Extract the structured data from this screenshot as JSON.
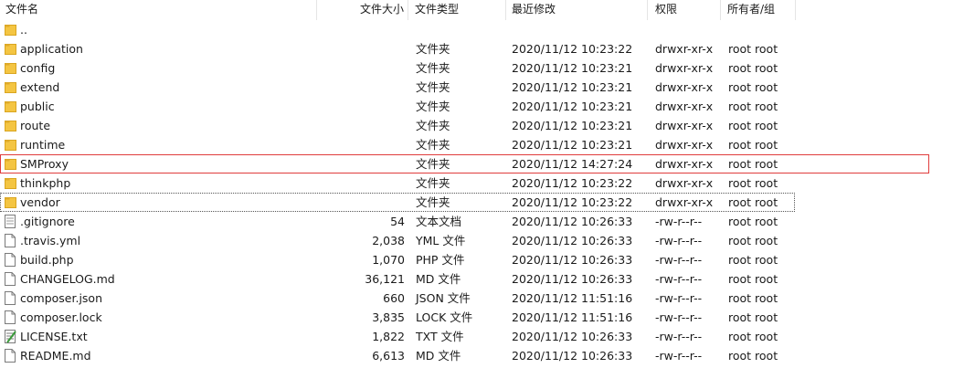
{
  "columns": {
    "name": "文件名",
    "size": "文件大小",
    "type": "文件类型",
    "mtime": "最近修改",
    "perm": "权限",
    "owner": "所有者/组"
  },
  "colors": {
    "folder": "#f4c542",
    "selection_outline": "#e03c3c"
  },
  "rows": [
    {
      "name": "..",
      "size": "",
      "type": "",
      "mtime": "",
      "perm": "",
      "owner": "",
      "icon": "folder-icon"
    },
    {
      "name": "application",
      "size": "",
      "type": "文件夹",
      "mtime": "2020/11/12 10:23:22",
      "perm": "drwxr-xr-x",
      "owner": "root root",
      "icon": "folder-icon"
    },
    {
      "name": "config",
      "size": "",
      "type": "文件夹",
      "mtime": "2020/11/12 10:23:21",
      "perm": "drwxr-xr-x",
      "owner": "root root",
      "icon": "folder-icon"
    },
    {
      "name": "extend",
      "size": "",
      "type": "文件夹",
      "mtime": "2020/11/12 10:23:21",
      "perm": "drwxr-xr-x",
      "owner": "root root",
      "icon": "folder-icon"
    },
    {
      "name": "public",
      "size": "",
      "type": "文件夹",
      "mtime": "2020/11/12 10:23:21",
      "perm": "drwxr-xr-x",
      "owner": "root root",
      "icon": "folder-icon"
    },
    {
      "name": "route",
      "size": "",
      "type": "文件夹",
      "mtime": "2020/11/12 10:23:21",
      "perm": "drwxr-xr-x",
      "owner": "root root",
      "icon": "folder-icon"
    },
    {
      "name": "runtime",
      "size": "",
      "type": "文件夹",
      "mtime": "2020/11/12 10:23:21",
      "perm": "drwxr-xr-x",
      "owner": "root root",
      "icon": "folder-icon"
    },
    {
      "name": "SMProxy",
      "size": "",
      "type": "文件夹",
      "mtime": "2020/11/12 14:27:24",
      "perm": "drwxr-xr-x",
      "owner": "root root",
      "icon": "folder-icon"
    },
    {
      "name": "thinkphp",
      "size": "",
      "type": "文件夹",
      "mtime": "2020/11/12 10:23:22",
      "perm": "drwxr-xr-x",
      "owner": "root root",
      "icon": "folder-icon"
    },
    {
      "name": "vendor",
      "size": "",
      "type": "文件夹",
      "mtime": "2020/11/12 10:23:22",
      "perm": "drwxr-xr-x",
      "owner": "root root",
      "icon": "folder-icon"
    },
    {
      "name": ".gitignore",
      "size": "54",
      "type": "文本文档",
      "mtime": "2020/11/12 10:26:33",
      "perm": "-rw-r--r--",
      "owner": "root root",
      "icon": "text-file-icon"
    },
    {
      "name": ".travis.yml",
      "size": "2,038",
      "type": "YML 文件",
      "mtime": "2020/11/12 10:26:33",
      "perm": "-rw-r--r--",
      "owner": "root root",
      "icon": "file-icon"
    },
    {
      "name": "build.php",
      "size": "1,070",
      "type": "PHP 文件",
      "mtime": "2020/11/12 10:26:33",
      "perm": "-rw-r--r--",
      "owner": "root root",
      "icon": "file-icon"
    },
    {
      "name": "CHANGELOG.md",
      "size": "36,121",
      "type": "MD 文件",
      "mtime": "2020/11/12 10:26:33",
      "perm": "-rw-r--r--",
      "owner": "root root",
      "icon": "file-icon"
    },
    {
      "name": "composer.json",
      "size": "660",
      "type": "JSON 文件",
      "mtime": "2020/11/12 11:51:16",
      "perm": "-rw-r--r--",
      "owner": "root root",
      "icon": "file-icon"
    },
    {
      "name": "composer.lock",
      "size": "3,835",
      "type": "LOCK 文件",
      "mtime": "2020/11/12 11:51:16",
      "perm": "-rw-r--r--",
      "owner": "root root",
      "icon": "file-icon"
    },
    {
      "name": "LICENSE.txt",
      "size": "1,822",
      "type": "TXT 文件",
      "mtime": "2020/11/12 10:26:33",
      "perm": "-rw-r--r--",
      "owner": "root root",
      "icon": "notepad-file-icon"
    },
    {
      "name": "README.md",
      "size": "6,613",
      "type": "MD 文件",
      "mtime": "2020/11/12 10:26:33",
      "perm": "-rw-r--r--",
      "owner": "root root",
      "icon": "file-icon"
    }
  ]
}
